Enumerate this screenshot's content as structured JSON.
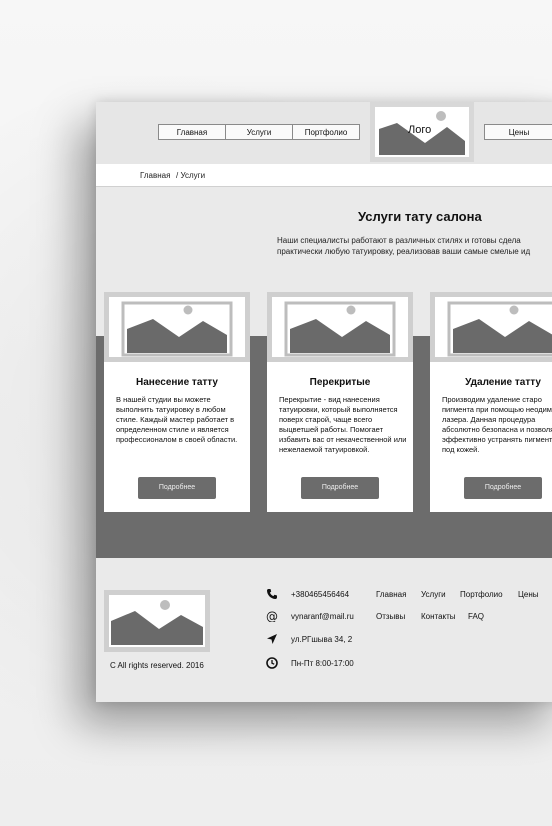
{
  "header": {
    "nav": [
      "Главная",
      "Услуги",
      "Портфолио"
    ],
    "logo": "Лого",
    "nav_right": [
      "Цены"
    ]
  },
  "breadcrumb": {
    "home": "Главная",
    "current": "/ Услуги"
  },
  "services": {
    "title": "Услуги тату салона",
    "description_line1": "Наши специалисты работают в различных стилях и готовы сдела",
    "description_line2": "практически любую татуировку, реализовав ваши самые смелые ид",
    "cards": [
      {
        "title": "Нанесение татту",
        "text": "В нашей студии вы можете выполнить татуировку в любом стиле. Каждый мастер работает в определенном стиле и является профессионалом в своей области.",
        "button": "Подробнее"
      },
      {
        "title": "Перекритые",
        "text": "Перекрытие - вид нанесения татуировки, который выполняется поверх старой, чаще всего выцветшей работы. Помогает избавить вас от некачественной или нежелаемой татуировкой.",
        "button": "Подробнее"
      },
      {
        "title": "Удаление татту",
        "text": "Производим удаление старо пигмента при помощью неодимового лазера. Данная процедура абсолютно безопасна и позволяет эффективно устранять пигменты под кожей.",
        "button": "Подробнее"
      }
    ]
  },
  "footer": {
    "copyright": "C All rights reserved. 2016",
    "contacts": {
      "phone": "+380465456464",
      "email": "vynaranf@mail.ru",
      "address": "ул.РГшыва 34, 2",
      "hours": "Пн-Пт 8:00-17:00"
    },
    "links_row1": [
      "Главная",
      "Услуги",
      "Портфолио",
      "Цены"
    ],
    "links_row2": [
      "Отзывы",
      "Контакты",
      "FAQ"
    ]
  },
  "colors": {
    "dark_band": "#6c6c6c",
    "page_bg": "#eaeaea",
    "placeholder_frame": "#cfcfcf"
  }
}
